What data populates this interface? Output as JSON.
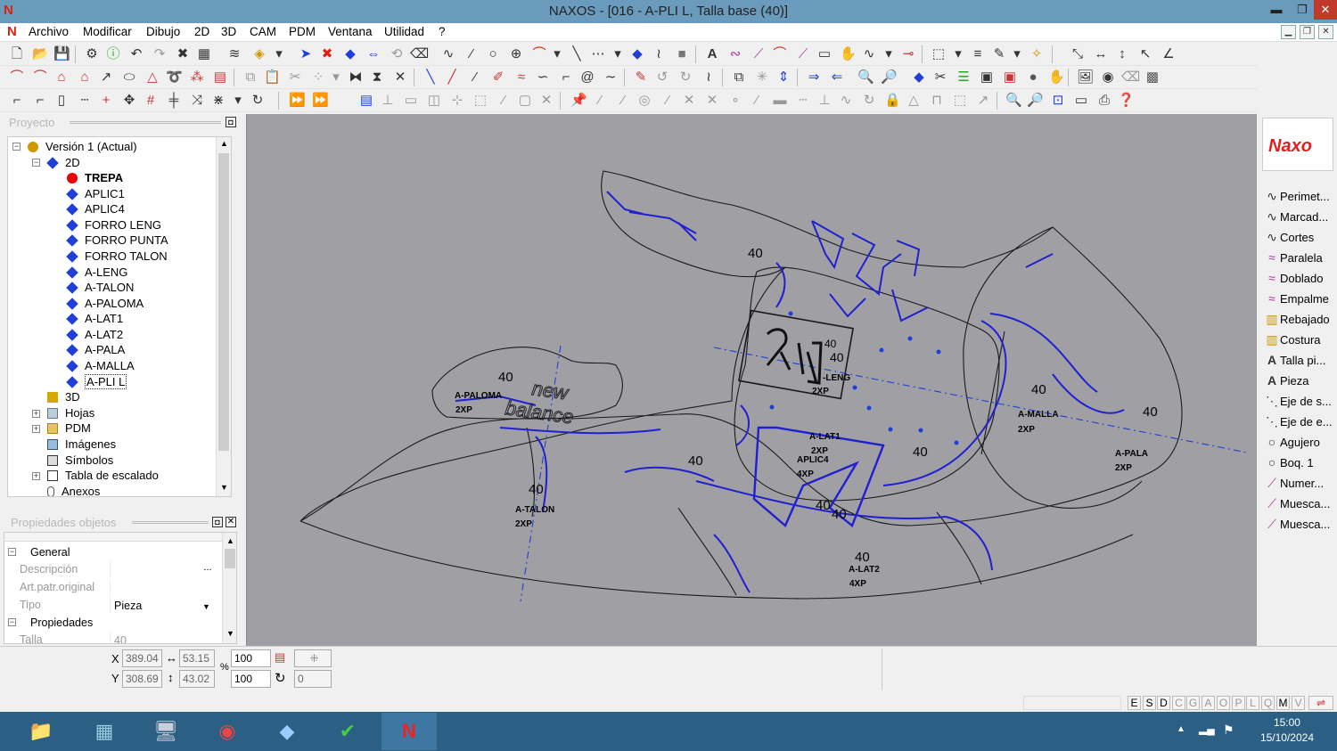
{
  "title": "NAXOS - [016 - A-PLI L, Talla base (40)]",
  "window_buttons": {
    "minimize": "▬",
    "maximize": "❐",
    "close": "✕"
  },
  "menu": [
    "Archivo",
    "Modificar",
    "Dibujo",
    "2D",
    "3D",
    "CAM",
    "PDM",
    "Ventana",
    "Utilidad",
    "?"
  ],
  "project_panel": {
    "title": "Proyecto",
    "tree": [
      {
        "label": "Versión 1 (Actual)",
        "icon": "version-icon"
      },
      {
        "label": "2D",
        "icon": "folder-2d-icon"
      },
      {
        "label": "TREPA",
        "icon": "red-dot-icon",
        "bold": true
      },
      {
        "label": "APLIC1",
        "icon": "blue-diamond-icon"
      },
      {
        "label": "APLIC4",
        "icon": "blue-diamond-icon"
      },
      {
        "label": "FORRO LENG",
        "icon": "blue-diamond-icon"
      },
      {
        "label": "FORRO PUNTA",
        "icon": "blue-diamond-icon"
      },
      {
        "label": "FORRO TALON",
        "icon": "blue-diamond-icon"
      },
      {
        "label": "A-LENG",
        "icon": "blue-diamond-icon"
      },
      {
        "label": "A-TALON",
        "icon": "blue-diamond-icon"
      },
      {
        "label": "A-PALOMA",
        "icon": "blue-diamond-icon"
      },
      {
        "label": "A-LAT1",
        "icon": "blue-diamond-icon"
      },
      {
        "label": "A-LAT2",
        "icon": "blue-diamond-icon"
      },
      {
        "label": "A-PALA",
        "icon": "blue-diamond-icon"
      },
      {
        "label": "A-MALLA",
        "icon": "blue-diamond-icon"
      },
      {
        "label": "A-PLI L",
        "icon": "blue-diamond-icon",
        "selected": true
      },
      {
        "label": "3D",
        "icon": "folder-3d-icon"
      },
      {
        "label": "Hojas",
        "icon": "sheets-icon"
      },
      {
        "label": "PDM",
        "icon": "folder-icon"
      },
      {
        "label": "Imágenes",
        "icon": "images-icon"
      },
      {
        "label": "Símbolos",
        "icon": "symbols-icon"
      },
      {
        "label": "Tabla de escalado",
        "icon": "table-icon"
      },
      {
        "label": "Anexos",
        "icon": "attachment-icon"
      }
    ]
  },
  "properties_panel": {
    "title": "Propiedades objetos",
    "general_group": "General",
    "rows": [
      {
        "key": "Descripción",
        "value": "",
        "button": "..."
      },
      {
        "key": "Art.patr.original",
        "value": ""
      },
      {
        "key": "Tipo",
        "value": "Pieza"
      }
    ],
    "properties_group": "Propiedades",
    "talla_key": "Talla",
    "talla_value": "40"
  },
  "canvas": {
    "labels": [
      {
        "text": "40"
      },
      {
        "text": "A-PALOMA"
      },
      {
        "text": "2XP"
      },
      {
        "text": "new"
      },
      {
        "text": "balance"
      },
      {
        "text": "40"
      },
      {
        "text": "A-TALON"
      },
      {
        "text": "2XP"
      },
      {
        "text": "40"
      },
      {
        "text": "40"
      },
      {
        "text": "40"
      },
      {
        "text": "-LENG"
      },
      {
        "text": "2XP"
      },
      {
        "text": "A-LAT1"
      },
      {
        "text": "2XP"
      },
      {
        "text": "APLIC4"
      },
      {
        "text": "4XP"
      },
      {
        "text": "40"
      },
      {
        "text": "40"
      },
      {
        "text": "40"
      },
      {
        "text": "40"
      },
      {
        "text": "A-LAT2"
      },
      {
        "text": "4XP"
      },
      {
        "text": "40"
      },
      {
        "text": "A-MALLA"
      },
      {
        "text": "2XP"
      },
      {
        "text": "40"
      },
      {
        "text": "A-PALA"
      },
      {
        "text": "2XP"
      }
    ]
  },
  "right_panel": {
    "logo": "Naxo",
    "items": [
      {
        "label": "Perimet...",
        "icon": "curve-icon"
      },
      {
        "label": "Marcad...",
        "icon": "curve-icon"
      },
      {
        "label": "Cortes",
        "icon": "curve-icon"
      },
      {
        "label": "Paralela",
        "icon": "parallel-icon"
      },
      {
        "label": "Doblado",
        "icon": "fold-icon"
      },
      {
        "label": "Empalme",
        "icon": "join-icon"
      },
      {
        "label": "Rebajado",
        "icon": "skive-icon"
      },
      {
        "label": "Costura",
        "icon": "seam-icon"
      },
      {
        "label": "Talla pi...",
        "icon": "text-a-icon"
      },
      {
        "label": "Pieza",
        "icon": "text-a-icon"
      },
      {
        "label": "Eje de s...",
        "icon": "axis-icon"
      },
      {
        "label": "Eje de e...",
        "icon": "axis-icon"
      },
      {
        "label": "Agujero",
        "icon": "circle-icon"
      },
      {
        "label": "Boq. 1",
        "icon": "circle-icon"
      },
      {
        "label": "Numer...",
        "icon": "notch-icon"
      },
      {
        "label": "Muesca...",
        "icon": "notch-icon"
      },
      {
        "label": "Muesca...",
        "icon": "notch-icon"
      }
    ]
  },
  "coordinates": {
    "x_label": "X",
    "y_label": "Y",
    "x": "389.04",
    "y": "308.69",
    "width": "53.15",
    "height": "43.02",
    "percent_label": "%",
    "scale_x": "100",
    "scale_y": "100",
    "rotation": "0"
  },
  "status_buttons": [
    "E",
    "S",
    "D",
    "C",
    "G",
    "A",
    "O",
    "P",
    "L",
    "Q",
    "M",
    "V"
  ],
  "taskbar": {
    "apps": [
      "file-explorer-icon",
      "calculator-icon",
      "network-app-icon",
      "chrome-icon",
      "app-icon",
      "green-app-icon",
      "naxos-icon"
    ],
    "time": "15:00",
    "date": "15/10/2024"
  }
}
